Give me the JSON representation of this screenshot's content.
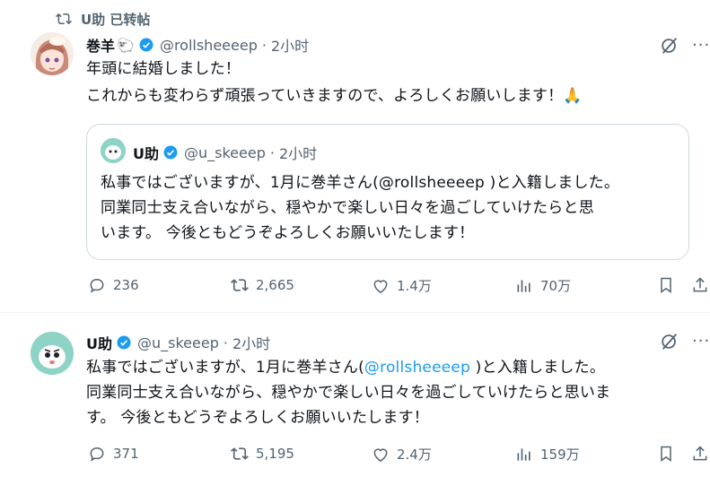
{
  "retweet": {
    "label": "U助 已转帖"
  },
  "post1": {
    "name": "巻羊",
    "emoji": "🐑",
    "handle": "@rollsheeeep",
    "dot": "·",
    "time": "2小时",
    "line1": "年頭に結婚しました！",
    "line2": "これからも変わらず頑張っていきますので、よろしくお願いします！🙏",
    "quote": {
      "name": "U助",
      "handle": "@u_skeeep",
      "dot": "·",
      "time": "2小时",
      "text": "私事ではございますが、1月に巻羊さん(@rollsheeeep )と入籍しました。\n 同業同士支え合いながら、穏やかで楽しい日々を過ごしていけたらと思\nいます。 今後ともどうぞよろしくお願いいたします！"
    },
    "actions": {
      "replies": "236",
      "reposts": "2,665",
      "likes": "1.4万",
      "views": "70万"
    }
  },
  "post2": {
    "name": "U助",
    "handle": "@u_skeeep",
    "dot": "·",
    "time": "2小时",
    "text_before": "私事ではございますが、1月に巻羊さん(",
    "mention": "@rollsheeeep",
    "text_after": " )と入籍しました。",
    "line2": " 同業同士支え合いながら、穏やかで楽しい日々を過ごしていけたらと思いま",
    "line3": "す。 今後ともどうぞよろしくお願いいたします！",
    "actions": {
      "replies": "371",
      "reposts": "5,195",
      "likes": "2.4万",
      "views": "159万"
    }
  },
  "more_label": "···",
  "colors": {
    "accent": "#1d9bf0",
    "muted": "#536471",
    "border": "#cfd9de"
  }
}
